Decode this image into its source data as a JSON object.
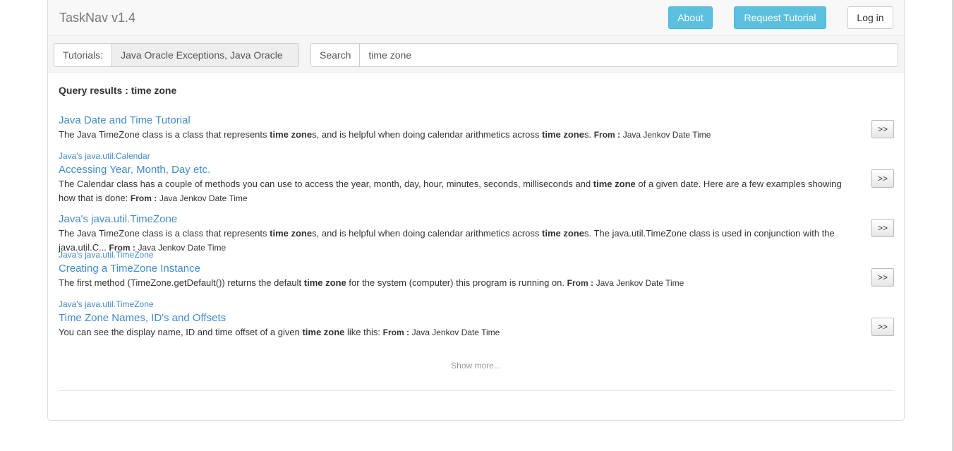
{
  "app": {
    "brand": "TaskNav v1.4"
  },
  "nav": {
    "about_label": "About",
    "request_label": "Request Tutorial",
    "login_label": "Log in"
  },
  "filters": {
    "tutorials_label": "Tutorials:",
    "tutorials_value": "Java Oracle Exceptions, Java Oracle",
    "search_label": "Search",
    "search_value": "time zone"
  },
  "results": {
    "heading": "Query results : time zone",
    "go_label": ">>",
    "show_more": "Show more...",
    "items": [
      {
        "category": "",
        "title": "Java Date and Time Tutorial",
        "desc_parts": [
          {
            "t": "The Java TimeZone class is a class that represents ",
            "b": false
          },
          {
            "t": "time zone",
            "b": true
          },
          {
            "t": "s, and is helpful when doing calendar arithmetics across ",
            "b": false
          },
          {
            "t": "time zone",
            "b": true
          },
          {
            "t": "s. ",
            "b": false
          }
        ],
        "from_label": "From :",
        "source": "Java Jenkov Date Time"
      },
      {
        "category": "Java's java.util.Calendar",
        "title": "Accessing Year, Month, Day etc.",
        "desc_parts": [
          {
            "t": "The Calendar class has a couple of methods you can use to access the year, month, day, hour, minutes, seconds, milliseconds and ",
            "b": false
          },
          {
            "t": "time zone",
            "b": true
          },
          {
            "t": " of a given date. Here are a few examples showing how that is done: ",
            "b": false
          }
        ],
        "from_label": "From :",
        "source": "Java Jenkov Date Time"
      },
      {
        "category": "",
        "title": "Java's java.util.TimeZone",
        "desc_parts": [
          {
            "t": "The Java TimeZone class is a class that represents ",
            "b": false
          },
          {
            "t": "time zone",
            "b": true
          },
          {
            "t": "s, and is helpful when doing calendar arithmetics across ",
            "b": false
          },
          {
            "t": "time zone",
            "b": true
          },
          {
            "t": "s. The java.util.TimeZone class is used in conjunction with the java.util.C... ",
            "b": false
          }
        ],
        "from_label": "From :",
        "source": "Java Jenkov Date Time"
      },
      {
        "category": "Java's java.util.TimeZone",
        "title": "Creating a TimeZone Instance",
        "desc_parts": [
          {
            "t": "The first method (TimeZone.getDefault()) returns the default ",
            "b": false
          },
          {
            "t": "time zone",
            "b": true
          },
          {
            "t": " for the system (computer) this program is running on. ",
            "b": false
          }
        ],
        "from_label": "From :",
        "source": "Java Jenkov Date Time"
      },
      {
        "category": "Java's java.util.TimeZone",
        "title": "Time Zone Names, ID's and Offsets",
        "desc_parts": [
          {
            "t": "You can see the display name, ID and time offset of a given ",
            "b": false
          },
          {
            "t": "time zone",
            "b": true
          },
          {
            "t": " like this: ",
            "b": false
          }
        ],
        "from_label": "From :",
        "source": "Java Jenkov Date Time"
      }
    ]
  },
  "colors": {
    "accent": "#5bc0de",
    "link": "#428bca"
  }
}
